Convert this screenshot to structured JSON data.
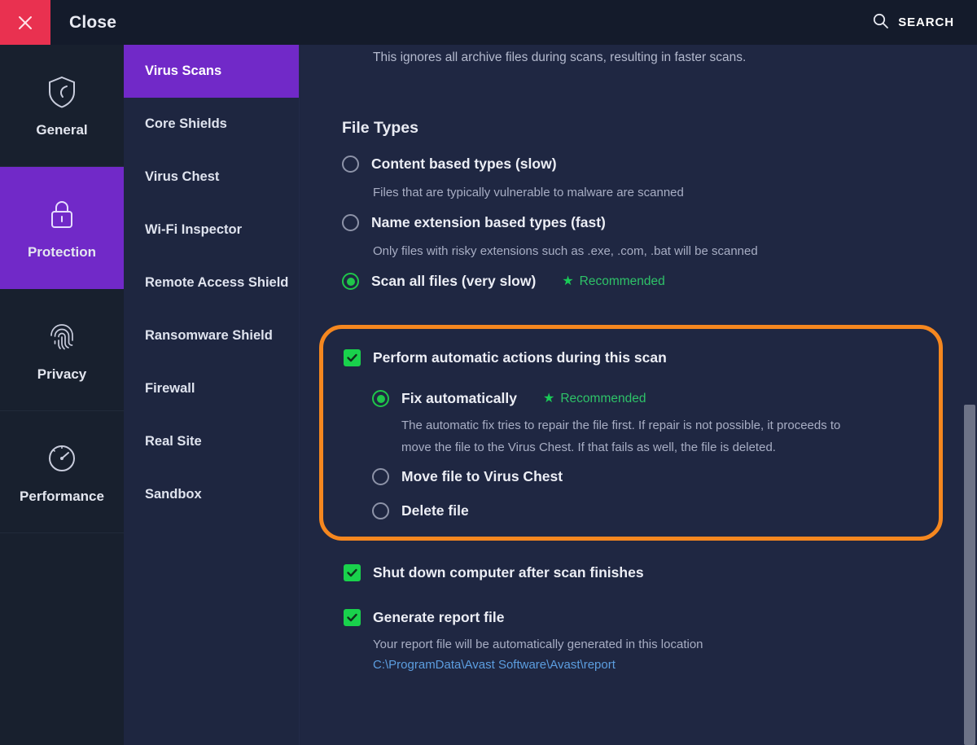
{
  "titlebar": {
    "close_label": "Close",
    "close_icon": "close-x-icon",
    "search_label": "SEARCH",
    "search_icon": "search-icon"
  },
  "sidebar": {
    "items": [
      {
        "label": "General",
        "icon": "shield-icon",
        "active": false
      },
      {
        "label": "Protection",
        "icon": "lock-icon",
        "active": true
      },
      {
        "label": "Privacy",
        "icon": "fingerprint-icon",
        "active": false
      },
      {
        "label": "Performance",
        "icon": "gauge-icon",
        "active": false
      }
    ]
  },
  "subnav": {
    "items": [
      {
        "label": "Virus Scans",
        "active": true
      },
      {
        "label": "Core Shields",
        "active": false
      },
      {
        "label": "Virus Chest",
        "active": false
      },
      {
        "label": "Wi-Fi Inspector",
        "active": false
      },
      {
        "label": "Remote Access Shield",
        "active": false
      },
      {
        "label": "Ransomware Shield",
        "active": false
      },
      {
        "label": "Firewall",
        "active": false
      },
      {
        "label": "Real Site",
        "active": false
      },
      {
        "label": "Sandbox",
        "active": false
      }
    ]
  },
  "main": {
    "lead_note": "This ignores all archive files during scans, resulting in faster scans.",
    "file_types_title": "File Types",
    "file_type_options": [
      {
        "label": "Content based types (slow)",
        "description": "Files that are typically vulnerable to malware are scanned",
        "selected": false,
        "recommended": false
      },
      {
        "label": "Name extension based types (fast)",
        "description": "Only files with risky extensions such as .exe, .com, .bat will be scanned",
        "selected": false,
        "recommended": false
      },
      {
        "label": "Scan all files (very slow)",
        "description": "",
        "selected": true,
        "recommended": true
      }
    ],
    "recommended_label": "Recommended",
    "recommended_star": "★",
    "auto_actions": {
      "checkbox_label": "Perform automatic actions during this scan",
      "checked": true,
      "options": [
        {
          "label": "Fix automatically",
          "selected": true,
          "recommended": true,
          "description_line1": "The automatic fix tries to repair the file first. If repair is not possible, it proceeds to",
          "description_line2": "move the file to the Virus Chest. If that fails as well, the file is deleted."
        },
        {
          "label": "Move file to Virus Chest",
          "selected": false,
          "recommended": false
        },
        {
          "label": "Delete file",
          "selected": false,
          "recommended": false
        }
      ]
    },
    "shutdown": {
      "label": "Shut down computer after scan finishes",
      "checked": true
    },
    "report": {
      "label": "Generate report file",
      "checked": true,
      "description": "Your report file will be automatically generated in this location",
      "path": "C:\\ProgramData\\Avast Software\\Avast\\report"
    }
  },
  "colors": {
    "accent_purple": "#7129c8",
    "close_red": "#e93150",
    "green": "#19d24c",
    "highlight_orange": "#f5871f",
    "link_blue": "#5c9ee0"
  }
}
